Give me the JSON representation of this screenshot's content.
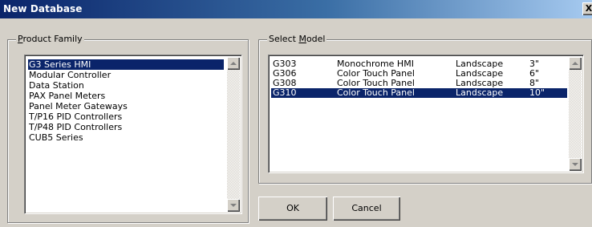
{
  "dialog": {
    "title": "New Database",
    "close_label": "X"
  },
  "product_family": {
    "legend_pre": "",
    "legend_accel": "P",
    "legend_post": "roduct Family",
    "items": [
      "G3 Series HMI",
      "Modular Controller",
      "Data Station",
      "PAX Panel Meters",
      "Panel Meter Gateways",
      "T/P16 PID Controllers",
      "T/P48 PID Controllers",
      "CUB5 Series"
    ],
    "selected_index": 0
  },
  "select_model": {
    "legend_pre": "Select ",
    "legend_accel": "M",
    "legend_post": "odel",
    "rows": [
      {
        "model": "G303",
        "type": "Monochrome HMI",
        "orientation": "Landscape",
        "size": "3\""
      },
      {
        "model": "G306",
        "type": "Color Touch Panel",
        "orientation": "Landscape",
        "size": "6\""
      },
      {
        "model": "G308",
        "type": "Color Touch Panel",
        "orientation": "Landscape",
        "size": "8\""
      },
      {
        "model": "G310",
        "type": "Color Touch Panel",
        "orientation": "Landscape",
        "size": "10\""
      }
    ],
    "selected_index": 3
  },
  "buttons": {
    "ok": "OK",
    "cancel": "Cancel"
  },
  "colors": {
    "selection": "#0a246a",
    "face": "#d4d0c8",
    "title_start": "#0a246a",
    "title_end": "#a6caf0"
  },
  "icons": {
    "scroll_up": "scroll-up-arrow",
    "scroll_down": "scroll-down-arrow"
  }
}
